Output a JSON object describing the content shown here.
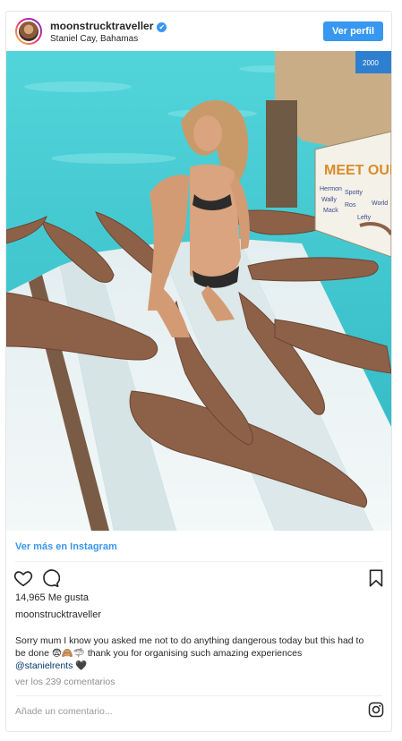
{
  "post": {
    "username": "moonstrucktraveller",
    "verified_mark": "✔",
    "location": "Staniel Cay, Bahamas",
    "profile_button": "Ver perfil",
    "view_more": "Ver más en Instagram",
    "likes": "14,965 Me gusta",
    "caption_author": "moonstrucktraveller",
    "caption_text": "Sorry mum I know you asked me not to do anything dangerous today but this had to be done 😨🙈🦈 thank you for organising such amazing experiences",
    "caption_mention": "@stanielrents",
    "caption_heart": "🖤",
    "comments_link": "ver los 239 comentarios",
    "comment_placeholder": "Añade un comentario..."
  },
  "photo": {
    "sign_title": "MEET OUR",
    "sign_lines": [
      "Hermon",
      "Wally",
      "Mack",
      "Spotty",
      "Ros",
      "Lefty",
      "World"
    ],
    "box_label": "2000"
  },
  "icons": {
    "like": "heart-icon",
    "comment": "comment-icon",
    "save": "bookmark-icon",
    "instagram": "instagram-icon"
  },
  "colors": {
    "accent": "#3897f0",
    "water": "#3ec6cf",
    "dock": "#e9f1f1",
    "shark": "#8d6148"
  }
}
